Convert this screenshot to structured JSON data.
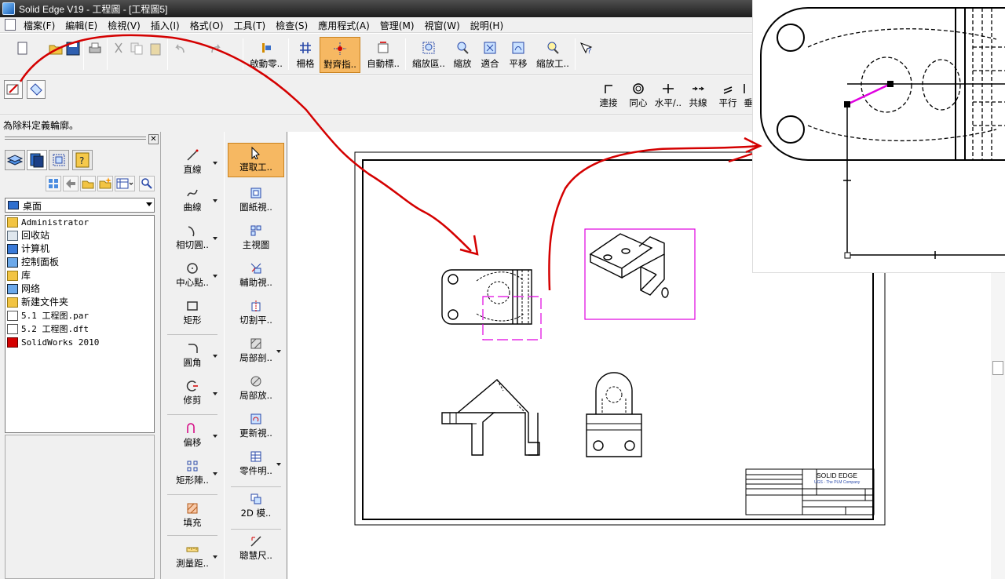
{
  "window": {
    "title": "Solid Edge V19 - 工程圖 - [工程圖5]"
  },
  "menu": [
    "檔案(F)",
    "編輯(E)",
    "檢視(V)",
    "插入(I)",
    "格式(O)",
    "工具(T)",
    "檢查(S)",
    "應用程式(A)",
    "管理(M)",
    "視窗(W)",
    "說明(H)"
  ],
  "toolbar": {
    "labels": [
      "啟動零..",
      "柵格",
      "對齊指..",
      "自動標..",
      "縮放區..",
      "縮放",
      "適合",
      "平移",
      "縮放工.."
    ]
  },
  "relations": [
    "連接",
    "同心",
    "水平/..",
    "共線",
    "平行",
    "垂"
  ],
  "status": "為除料定義輪廓。",
  "library": {
    "folder": "桌面",
    "items": [
      "Administrator",
      "回收站",
      "计算机",
      "控制面板",
      "库",
      "网络",
      "新建文件夹",
      "5.1 工程图.par",
      "5.2 工程图.dft",
      "SolidWorks 2010"
    ]
  },
  "palette1": [
    "直線",
    "曲線",
    "相切圓..",
    "中心點..",
    "矩形",
    "圓角",
    "修剪",
    "偏移",
    "矩形陣..",
    "填充",
    "測量距.."
  ],
  "palette2": [
    "選取工..",
    "圖紙視..",
    "主視圖",
    "輔助視..",
    "切割平..",
    "局部剖..",
    "局部放..",
    "更新視..",
    "零件明..",
    "2D 模..",
    "聰慧尺.."
  ],
  "titleblock": {
    "company": "SOLID EDGE",
    "subtitle": "UGS - The PLM Company"
  },
  "colors": {
    "annotation": "#d40000",
    "selection": "#e000e0",
    "active_tool": "#f6b862"
  }
}
